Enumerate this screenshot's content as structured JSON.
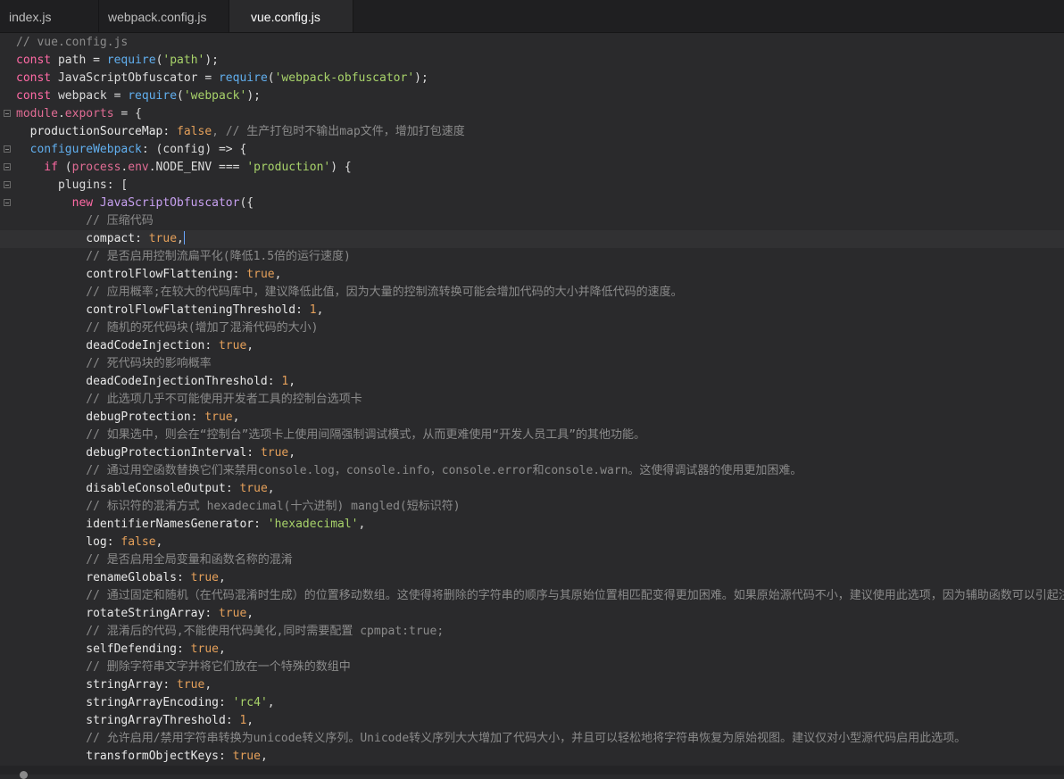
{
  "tabs": [
    {
      "label": "index.js",
      "active": false
    },
    {
      "label": "webpack.config.js",
      "active": false
    },
    {
      "label": "vue.config.js",
      "active": true
    }
  ],
  "colors": {
    "background": "#2a2a2c",
    "keyword": "#ff6aa5",
    "string": "#a8d36a",
    "number": "#e5a05a",
    "comment": "#8b8b8b",
    "function": "#61afef",
    "cursor": "#6aa7ff"
  },
  "code": {
    "l1": "// vue.config.js",
    "l2_kw": "const",
    "l2_var": " path = ",
    "l2_fn": "require",
    "l2_s": "'path'",
    "l2_end": ");",
    "l3_kw": "const",
    "l3_var": " JavaScriptObfuscator = ",
    "l3_fn": "require",
    "l3_s": "'webpack-obfuscator'",
    "l3_end": ");",
    "l4_kw": "const",
    "l4_var": " webpack = ",
    "l4_fn": "require",
    "l4_s": "'webpack'",
    "l4_end": ");",
    "l5_a": "module",
    "l5_b": ".",
    "l5_c": "exports",
    "l5_d": " = {",
    "l6_p": "  productionSourceMap",
    "l6_c": ": ",
    "l6_v": "false",
    "l6_cm": ", // 生产打包时不输出map文件，增加打包速度",
    "l7_p": "  configureWebpack",
    "l7_c": ": (config) => {",
    "l8_kw": "    if",
    "l8_a": " (",
    "l8_b": "process",
    "l8_c": ".",
    "l8_d": "env",
    "l8_e": ".NODE_ENV === ",
    "l8_s": "'production'",
    "l8_f": ") {",
    "l9": "      plugins: [",
    "l10_kw": "        new",
    "l10_cls": " JavaScriptObfuscator",
    "l10_end": "({",
    "l11": "          // 压缩代码",
    "l12_p": "          compact",
    "l12_c": ": ",
    "l12_v": "true",
    "l12_e": ",",
    "l13": "          // 是否启用控制流扁平化(降低1.5倍的运行速度)",
    "l14_p": "          controlFlowFlattening",
    "l14_v": "true",
    "l15": "          // 应用概率;在较大的代码库中，建议降低此值，因为大量的控制流转换可能会增加代码的大小并降低代码的速度。",
    "l16_p": "          controlFlowFlatteningThreshold",
    "l16_v": "1",
    "l17": "          // 随机的死代码块(增加了混淆代码的大小)",
    "l18_p": "          deadCodeInjection",
    "l18_v": "true",
    "l19": "          // 死代码块的影响概率",
    "l20_p": "          deadCodeInjectionThreshold",
    "l20_v": "1",
    "l21": "          // 此选项几乎不可能使用开发者工具的控制台选项卡",
    "l22_p": "          debugProtection",
    "l22_v": "true",
    "l23": "          // 如果选中，则会在“控制台”选项卡上使用间隔强制调试模式，从而更难使用“开发人员工具”的其他功能。",
    "l24_p": "          debugProtectionInterval",
    "l24_v": "true",
    "l25": "          // 通过用空函数替换它们来禁用console.log，console.info，console.error和console.warn。这使得调试器的使用更加困难。",
    "l26_p": "          disableConsoleOutput",
    "l26_v": "true",
    "l27": "          // 标识符的混淆方式 hexadecimal(十六进制) mangled(短标识符)",
    "l28_p": "          identifierNamesGenerator",
    "l28_s": "'hexadecimal'",
    "l29_p": "          log",
    "l29_v": "false",
    "l30": "          // 是否启用全局变量和函数名称的混淆",
    "l31_p": "          renameGlobals",
    "l31_v": "true",
    "l32": "          // 通过固定和随机（在代码混淆时生成）的位置移动数组。这使得将删除的字符串的顺序与其原始位置相匹配变得更加困难。如果原始源代码不小，建议使用此选项，因为辅助函数可以引起注",
    "l33_p": "          rotateStringArray",
    "l33_v": "true",
    "l34": "          // 混淆后的代码,不能使用代码美化,同时需要配置 cpmpat:true;",
    "l35_p": "          selfDefending",
    "l35_v": "true",
    "l36": "          // 删除字符串文字并将它们放在一个特殊的数组中",
    "l37_p": "          stringArray",
    "l37_v": "true",
    "l38_p": "          stringArrayEncoding",
    "l38_s": "'rc4'",
    "l39_p": "          stringArrayThreshold",
    "l39_v": "1",
    "l40": "          // 允许启用/禁用字符串转换为unicode转义序列。Unicode转义序列大大增加了代码大小，并且可以轻松地将字符串恢复为原始视图。建议仅对小型源代码启用此选项。",
    "l41_p": "          transformObjectKeys",
    "l41_v": "true",
    "colon": ": ",
    "comma": ","
  }
}
